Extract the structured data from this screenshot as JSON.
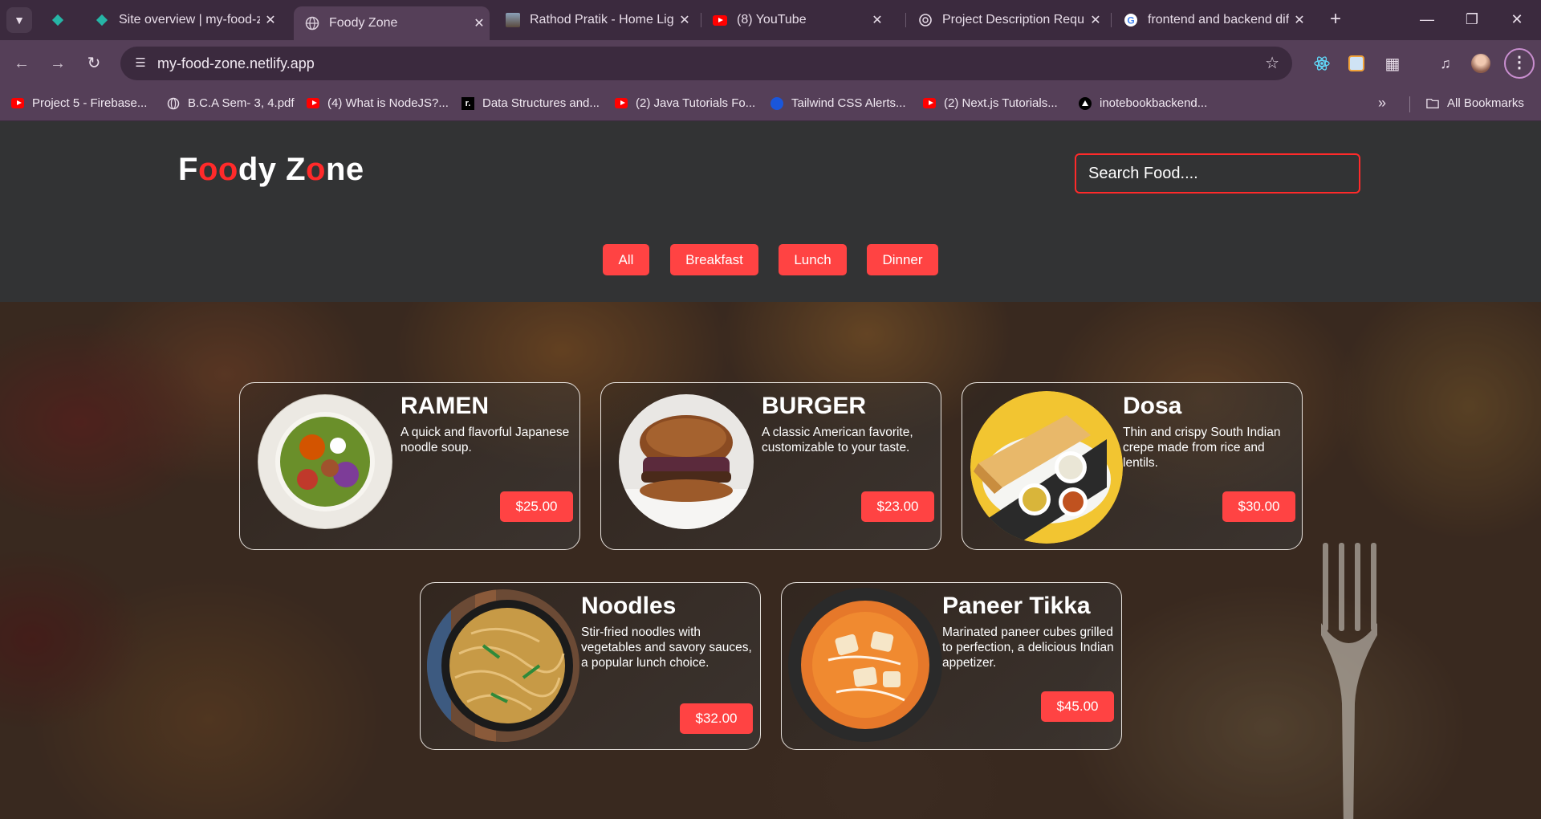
{
  "browser": {
    "tabs": [
      {
        "title": "Site overview | my-food-z",
        "icon": "netlify-icon"
      },
      {
        "title": "Foody Zone",
        "icon": "globe-icon",
        "active": true
      },
      {
        "title": "Rathod Pratik - Home Lig",
        "icon": "profile-photo-icon"
      },
      {
        "title": "(8) YouTube",
        "icon": "youtube-icon"
      },
      {
        "title": "Project Description Requ",
        "icon": "chatgpt-icon"
      },
      {
        "title": "frontend and backend dif",
        "icon": "google-icon"
      }
    ],
    "url": "my-food-zone.netlify.app",
    "bookmarks": [
      {
        "label": "Project 5 - Firebase...",
        "icon": "youtube-icon"
      },
      {
        "label": "B.C.A Sem- 3, 4.pdf",
        "icon": "globe-icon"
      },
      {
        "label": "(4) What is NodeJS?...",
        "icon": "youtube-icon"
      },
      {
        "label": "Data Structures and...",
        "icon": "codehelp-icon"
      },
      {
        "label": "(2) Java Tutorials Fo...",
        "icon": "youtube-icon"
      },
      {
        "label": "Tailwind CSS Alerts...",
        "icon": "flowbite-icon"
      },
      {
        "label": "(2) Next.js Tutorials...",
        "icon": "youtube-icon"
      },
      {
        "label": "inotebookbackend...",
        "icon": "vercel-icon"
      }
    ],
    "all_bookmarks_label": "All Bookmarks"
  },
  "site": {
    "logo": {
      "p1": "F",
      "p2": "oo",
      "p3": "dy Z",
      "p4": "o",
      "p5": "ne"
    },
    "search_placeholder": "Search Food....",
    "filters": [
      "All",
      "Breakfast",
      "Lunch",
      "Dinner"
    ],
    "foods": [
      {
        "name": "RAMEN",
        "description": "A quick and flavorful Japanese noodle soup.",
        "price": "$25.00"
      },
      {
        "name": "BURGER",
        "description": "A classic American favorite, customizable to your taste.",
        "price": "$23.00"
      },
      {
        "name": "Dosa",
        "description": "Thin and crispy South Indian crepe made from rice and lentils.",
        "price": "$30.00"
      },
      {
        "name": "Noodles",
        "description": "Stir-fried noodles with vegetables and savory sauces, a popular lunch choice.",
        "price": "$32.00"
      },
      {
        "name": "Paneer Tikka",
        "description": "Marinated paneer cubes grilled to perfection, a delicious Indian appetizer.",
        "price": "$45.00"
      }
    ]
  },
  "colors": {
    "accent": "#ff4343",
    "logo_red": "#ff2a2a",
    "header_bg": "#323334",
    "chrome": "#553f58"
  }
}
